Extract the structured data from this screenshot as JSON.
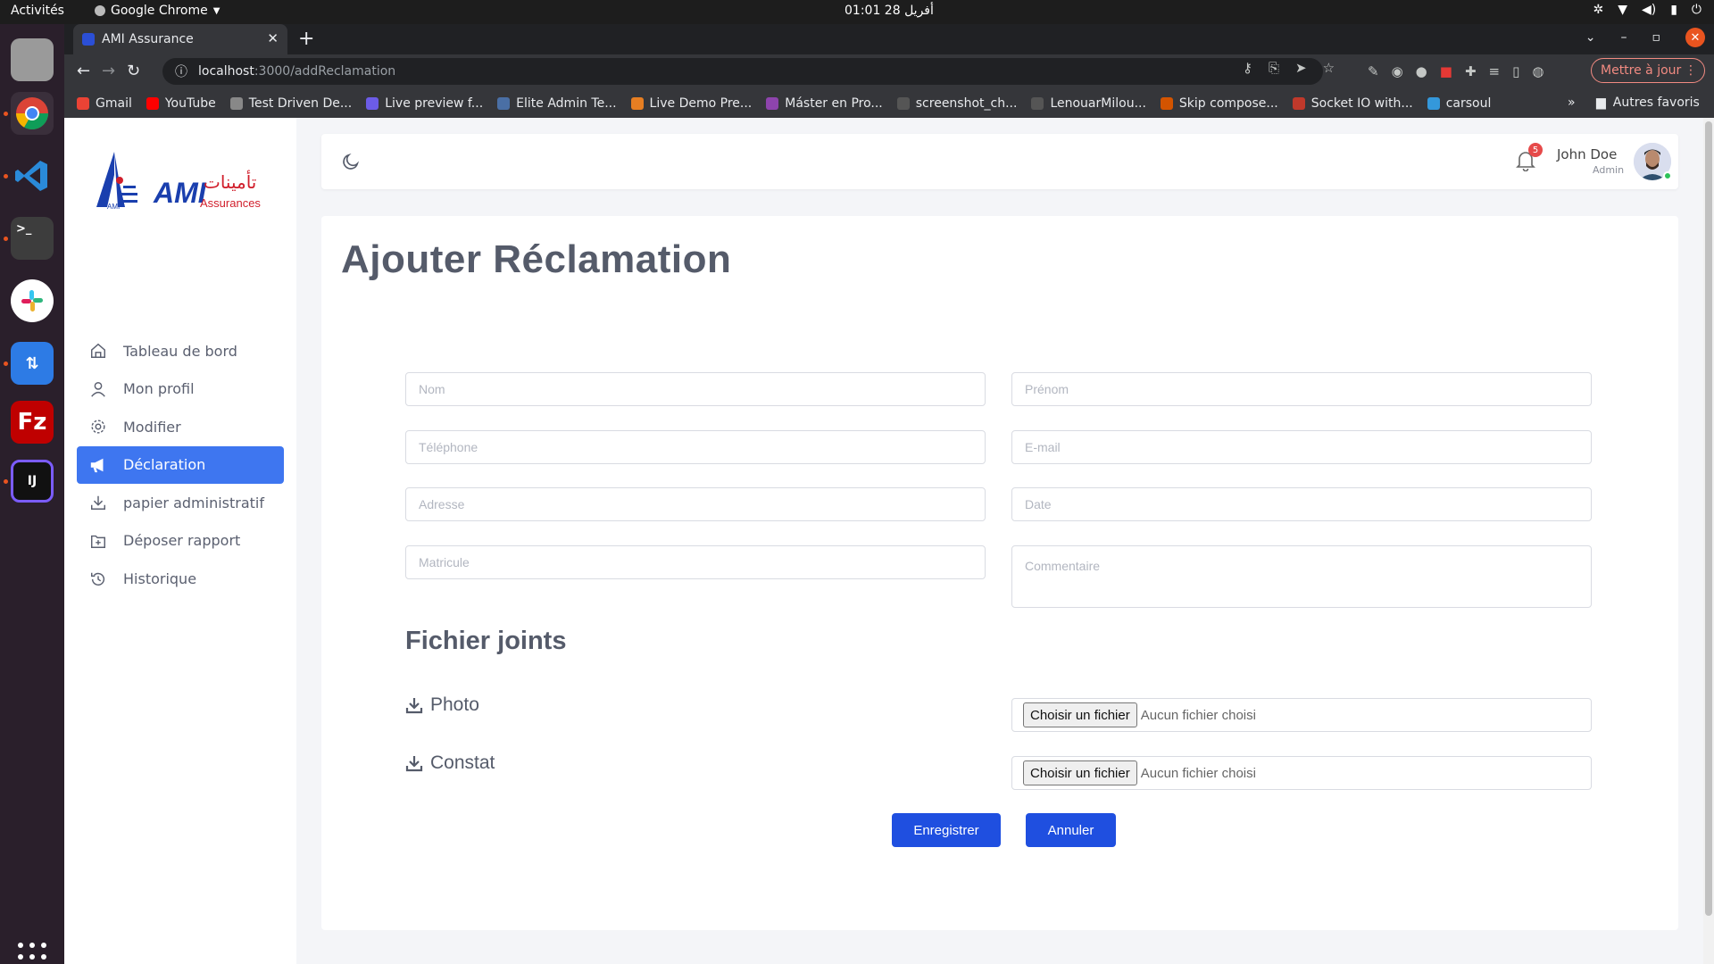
{
  "os": {
    "activities": "Activités",
    "app_name": "Google Chrome",
    "clock": "01:01  أفريل 28"
  },
  "browser": {
    "tab_title": "AMI Assurance",
    "url_host": "localhost",
    "url_path": ":3000/addReclamation",
    "update_button": "Mettre à jour",
    "bookmarks": [
      {
        "label": "Gmail",
        "color": "#ea4335"
      },
      {
        "label": "YouTube",
        "color": "#ff0000"
      },
      {
        "label": "Test Driven De...",
        "color": "#888888"
      },
      {
        "label": "Live preview f...",
        "color": "#6c5ce7"
      },
      {
        "label": "Elite Admin Te...",
        "color": "#4a6fa5"
      },
      {
        "label": "Live Demo Pre...",
        "color": "#e67e22"
      },
      {
        "label": "Máster en Pro...",
        "color": "#8e44ad"
      },
      {
        "label": "screenshot_ch...",
        "color": "#555555"
      },
      {
        "label": "LenouarMilou...",
        "color": "#555555"
      },
      {
        "label": "Skip compose...",
        "color": "#d35400"
      },
      {
        "label": "Socket IO with...",
        "color": "#c0392b"
      },
      {
        "label": "carsoul",
        "color": "#3498db"
      }
    ],
    "bookmarks_more": "»",
    "other_bookmarks": "Autres favoris"
  },
  "sidebar": {
    "logo_text": "AMI",
    "logo_sub": "Assurances",
    "logo_arabic": "تأمينات",
    "items": [
      {
        "label": "Tableau de bord",
        "icon": "home-icon",
        "active": false
      },
      {
        "label": "Mon profil",
        "icon": "user-icon",
        "active": false
      },
      {
        "label": "Modifier",
        "icon": "gear-icon",
        "active": false
      },
      {
        "label": "Déclaration",
        "icon": "megaphone-icon",
        "active": true
      },
      {
        "label": "papier administratif",
        "icon": "download-icon",
        "active": false
      },
      {
        "label": "Déposer rapport",
        "icon": "file-add-icon",
        "active": false
      },
      {
        "label": "Historique",
        "icon": "history-icon",
        "active": false
      }
    ]
  },
  "header": {
    "notification_count": "5",
    "user_name": "John Doe",
    "user_role": "Admin"
  },
  "form": {
    "title": "Ajouter Réclamation",
    "fields": {
      "nom": "Nom",
      "prenom": "Prénom",
      "telephone": "Téléphone",
      "email": "E-mail",
      "adresse": "Adresse",
      "date": "Date",
      "matricule": "Matricule",
      "commentaire": "Commentaire"
    },
    "attachments_title": "Fichier joints",
    "photo_label": "Photo",
    "constat_label": "Constat",
    "file_button": "Choisir un fichier",
    "file_none": "Aucun fichier choisi",
    "save_button": "Enregistrer",
    "cancel_button": "Annuler"
  },
  "colors": {
    "accent": "#3e76f0",
    "button": "#1f4fe0",
    "badge": "#e64a4a"
  }
}
